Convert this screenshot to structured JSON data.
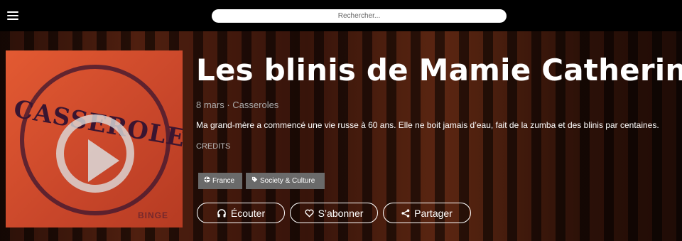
{
  "header": {
    "menu_icon": "hamburger-menu-icon",
    "search": {
      "placeholder": "Rechercher..."
    }
  },
  "podcast": {
    "cover": {
      "art_text": "CASSEROLES",
      "brand": "BINGE",
      "accent_color": "#e35a32"
    },
    "title": "Les blinis de Mamie Catherine",
    "meta": "8 mars · Casseroles",
    "description": "Ma grand-mère a commencé une vie russe à 60 ans. Elle ne boit jamais d’eau, fait de la zumba et des blinis par centaines.",
    "credits_label": "CREDITS",
    "tags": [
      {
        "label": "France",
        "icon": "globe-icon"
      },
      {
        "label": "Society & Culture",
        "icon": "tag-icon"
      }
    ],
    "actions": {
      "listen": {
        "label": "Écouter",
        "icon": "headphones-icon"
      },
      "subscribe": {
        "label": "S’abonner",
        "icon": "heart-icon"
      },
      "share": {
        "label": "Partager",
        "icon": "share-icon"
      }
    }
  }
}
